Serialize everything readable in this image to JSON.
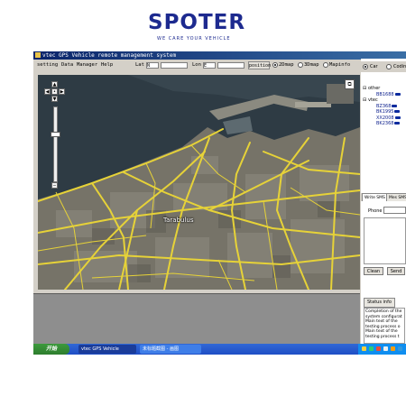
{
  "logo": {
    "name": "SPOTER",
    "tagline": "WE CARE YOUR VEHICLE"
  },
  "window": {
    "title": "vtec GPS Vehicle remote management system"
  },
  "menu": [
    "setting",
    "Data",
    "Manager",
    "Help"
  ],
  "toolbar": {
    "lat_label": "Lat",
    "lat_dir": "N",
    "lon_label": "Lon",
    "lon_dir": "E",
    "position_button": "position",
    "modes": [
      {
        "label": "2Dmap",
        "selected": true
      },
      {
        "label": "3Dmap",
        "selected": false
      },
      {
        "label": "Mapinfo",
        "selected": false
      }
    ]
  },
  "map": {
    "place_label": "Tarabulus"
  },
  "right_panel": {
    "view_options": [
      {
        "label": "Car",
        "selected": true
      },
      {
        "label": "Codin",
        "selected": false
      }
    ],
    "groups": [
      {
        "name": "other",
        "vehicles": [
          "BB1688"
        ]
      },
      {
        "name": "vtec",
        "vehicles": [
          "BZ368",
          "BK1995",
          "XX2008",
          "BK2368"
        ]
      }
    ],
    "tabs": [
      "Write SMS",
      "Mes SMS"
    ],
    "phone_label": "Phone",
    "clean_button": "Clean",
    "send_button": "Send",
    "status_tab": "Status info",
    "status_lines": [
      "Completion of the",
      "system configurat",
      "Main text of the",
      "testing process o",
      "Main text of the",
      "testing process t"
    ]
  },
  "taskbar": {
    "start": "开始",
    "tasks": [
      {
        "label": "vtec GPS Vehicle",
        "active": true
      },
      {
        "label": "未标题截图 - 画图",
        "active": false
      }
    ]
  }
}
